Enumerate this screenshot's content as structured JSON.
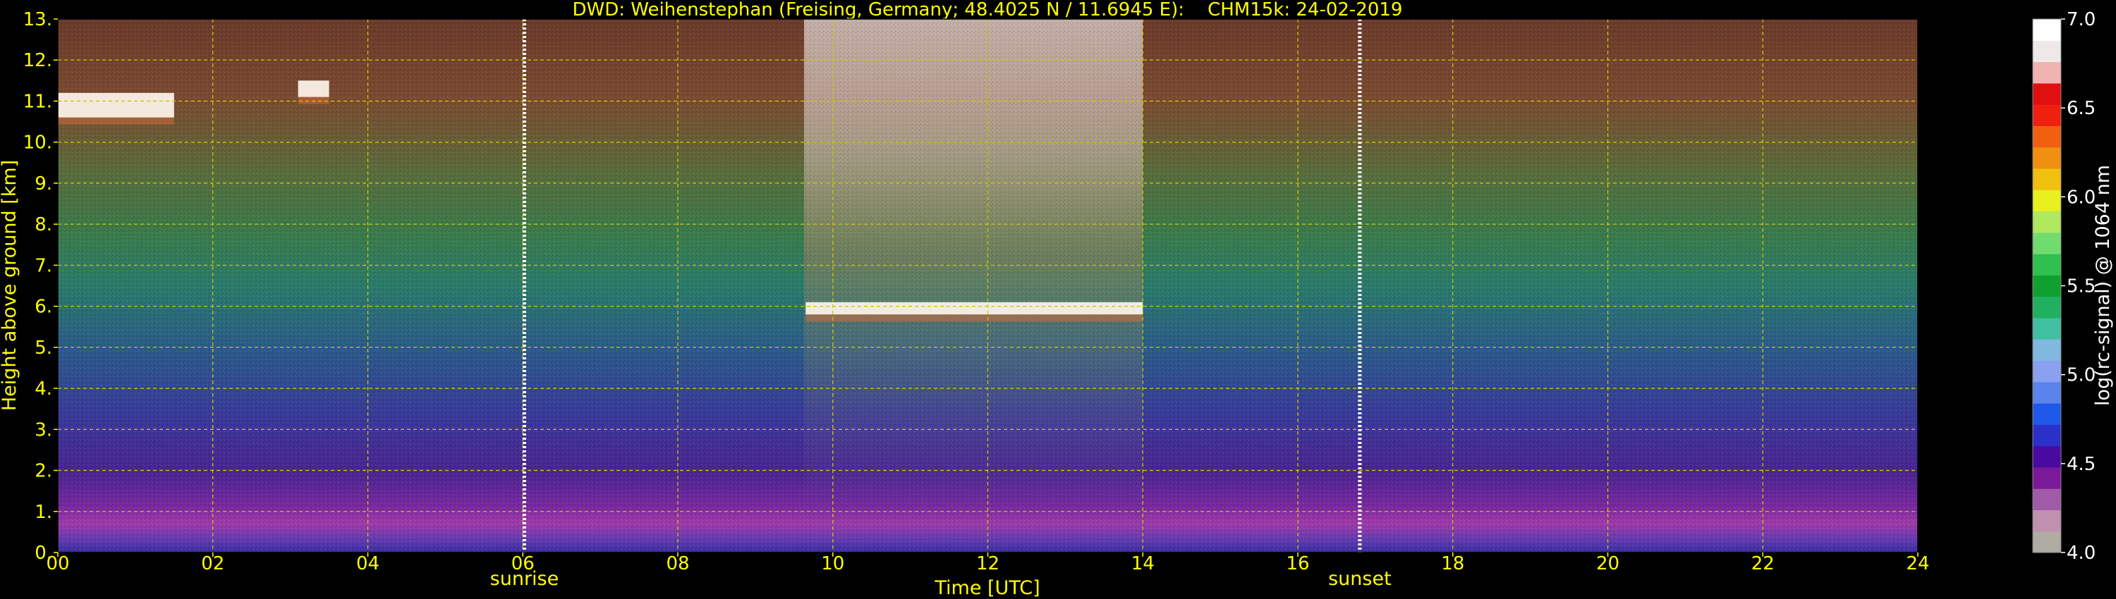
{
  "chart_data": {
    "type": "heatmap",
    "title": "DWD: Weihenstephan (Freising, Germany; 48.4025 N / 11.6945 E):    CHM15k: 24-02-2019",
    "xlabel": "Time [UTC]",
    "ylabel": "Height above ground [km]",
    "xlim": [
      0,
      24
    ],
    "ylim": [
      0,
      13
    ],
    "x_ticks": [
      0,
      2,
      4,
      6,
      8,
      10,
      12,
      14,
      16,
      18,
      20,
      22,
      24
    ],
    "x_tick_labels": [
      "00",
      "02",
      "04",
      "06",
      "08",
      "10",
      "12",
      "14",
      "16",
      "18",
      "20",
      "22",
      "24"
    ],
    "y_ticks": [
      0,
      1,
      2,
      3,
      4,
      5,
      6,
      7,
      8,
      9,
      10,
      11,
      12,
      13
    ],
    "y_tick_labels": [
      "0.",
      "1.",
      "2.",
      "3.",
      "4.",
      "5.",
      "6.",
      "7.",
      "8.",
      "9.",
      "10.",
      "11.",
      "12.",
      "13."
    ],
    "grid": true,
    "annotations": [
      {
        "label": "sunrise",
        "x": 6.02
      },
      {
        "label": "sunset",
        "x": 16.8
      }
    ],
    "cloud_layers": [
      {
        "x_start": 9.65,
        "x_end": 14.0,
        "base_km": 5.8,
        "top_km": 6.1
      },
      {
        "x_start": 0.0,
        "x_end": 1.5,
        "base_km": 10.6,
        "top_km": 11.2
      },
      {
        "x_start": 3.1,
        "x_end": 3.5,
        "base_km": 11.1,
        "top_km": 11.5
      }
    ],
    "colorbar": {
      "label": "log(rc-signal) @ 1064 nm",
      "min": 4.0,
      "max": 7.0,
      "ticks": [
        4.0,
        4.5,
        5.0,
        5.5,
        6.0,
        6.5,
        7.0
      ],
      "tick_labels": [
        "4.0",
        "4.5",
        "5.0",
        "5.5",
        "6.0",
        "6.5",
        "7.0"
      ],
      "colors": [
        "#b0aca4",
        "#c090b0",
        "#a05aa8",
        "#7a1a98",
        "#4a0aa0",
        "#2a30c8",
        "#1e58e8",
        "#5a84ec",
        "#8aa0f0",
        "#80b8e0",
        "#40c0a0",
        "#20b060",
        "#10a030",
        "#30c050",
        "#70dc70",
        "#b0e860",
        "#e8f020",
        "#f0c010",
        "#f09010",
        "#f06010",
        "#f02010",
        "#e01010",
        "#f0b4b0",
        "#f0e8e8",
        "#ffffff"
      ]
    }
  },
  "colors": {
    "text": "#ffff00",
    "grid": "#c8c800",
    "colorbar_text": "#ffffff",
    "background": "#000000"
  }
}
